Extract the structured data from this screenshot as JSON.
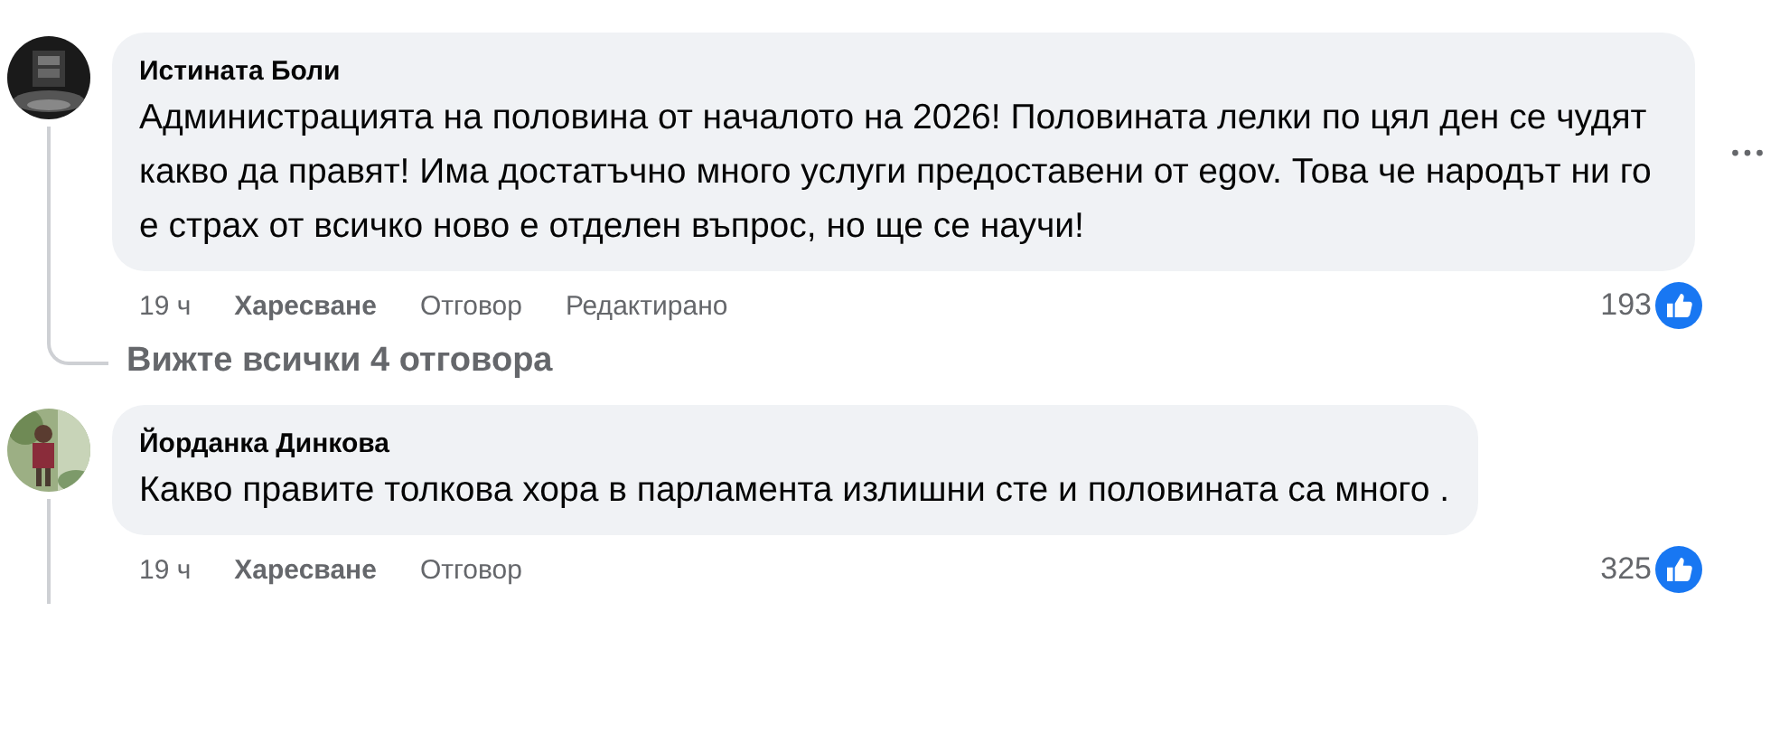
{
  "comments": [
    {
      "author": "Истината Боли",
      "text": "Администрацията на половина от началото на 2026! Половината лелки по цял ден се чудят какво да правят! Има достатъчно много услуги предоставени от egov. Това че народът ни го е страх от всичко ново е отделен въпрос, но ще се научи!",
      "time": "19 ч",
      "actions": [
        {
          "label": "Харесване",
          "kind": "like"
        },
        {
          "label": "Отговор",
          "kind": "reply"
        },
        {
          "label": "Редактирано",
          "kind": "status"
        }
      ],
      "reactions": "193",
      "menu_visible": true,
      "replies_link": "Вижте всички 4 отговора"
    },
    {
      "author": "Йорданка Динкова",
      "text": "Какво правите толкова хора в парламента излишни сте и половината са много .",
      "time": "19 ч",
      "actions": [
        {
          "label": "Харесване",
          "kind": "like"
        },
        {
          "label": "Отговор",
          "kind": "reply"
        }
      ],
      "reactions": "325",
      "menu_visible": false
    }
  ]
}
